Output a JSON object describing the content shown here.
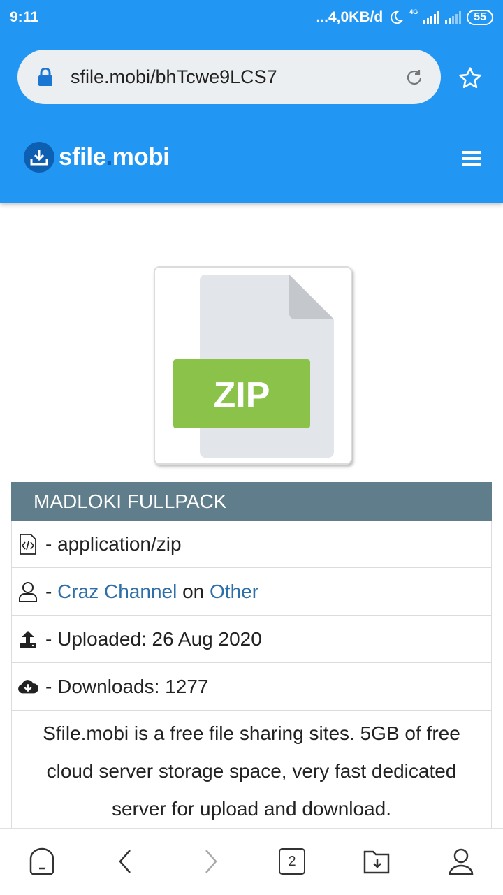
{
  "status": {
    "time": "9:11",
    "network_speed": "...4,0KB/d",
    "network_type": "4G",
    "battery": "55"
  },
  "browser": {
    "url": "sfile.mobi/bhTcwe9LCS7",
    "tab_count": "2"
  },
  "site": {
    "logo_name": "sfile",
    "logo_dot": ".",
    "logo_tld": "mobi"
  },
  "file": {
    "type_badge": "ZIP",
    "name": "MADLOKI FULLPACK",
    "mime": "- application/zip",
    "owner_prefix": "- ",
    "owner_name": "Craz Channel",
    "owner_on": " on ",
    "owner_category": "Other",
    "uploaded": "- Uploaded: 26 Aug 2020",
    "downloads": "- Downloads: 1277",
    "description": "Sfile.mobi is a free file sharing sites. 5GB of free cloud server storage space, very fast dedicated server for upload and download."
  },
  "colors": {
    "primary": "#2196f3",
    "title_bar": "#607d8b",
    "zip_badge": "#8bc34a",
    "link": "#2f6fa8"
  },
  "icons": [
    "lock-icon",
    "reload-icon",
    "star-icon",
    "sfile-logo-icon",
    "menu-icon",
    "file-code-icon",
    "user-icon",
    "upload-icon",
    "cloud-download-icon",
    "home-icon",
    "back-icon",
    "forward-icon",
    "tabs-icon",
    "downloads-icon",
    "profile-icon"
  ]
}
